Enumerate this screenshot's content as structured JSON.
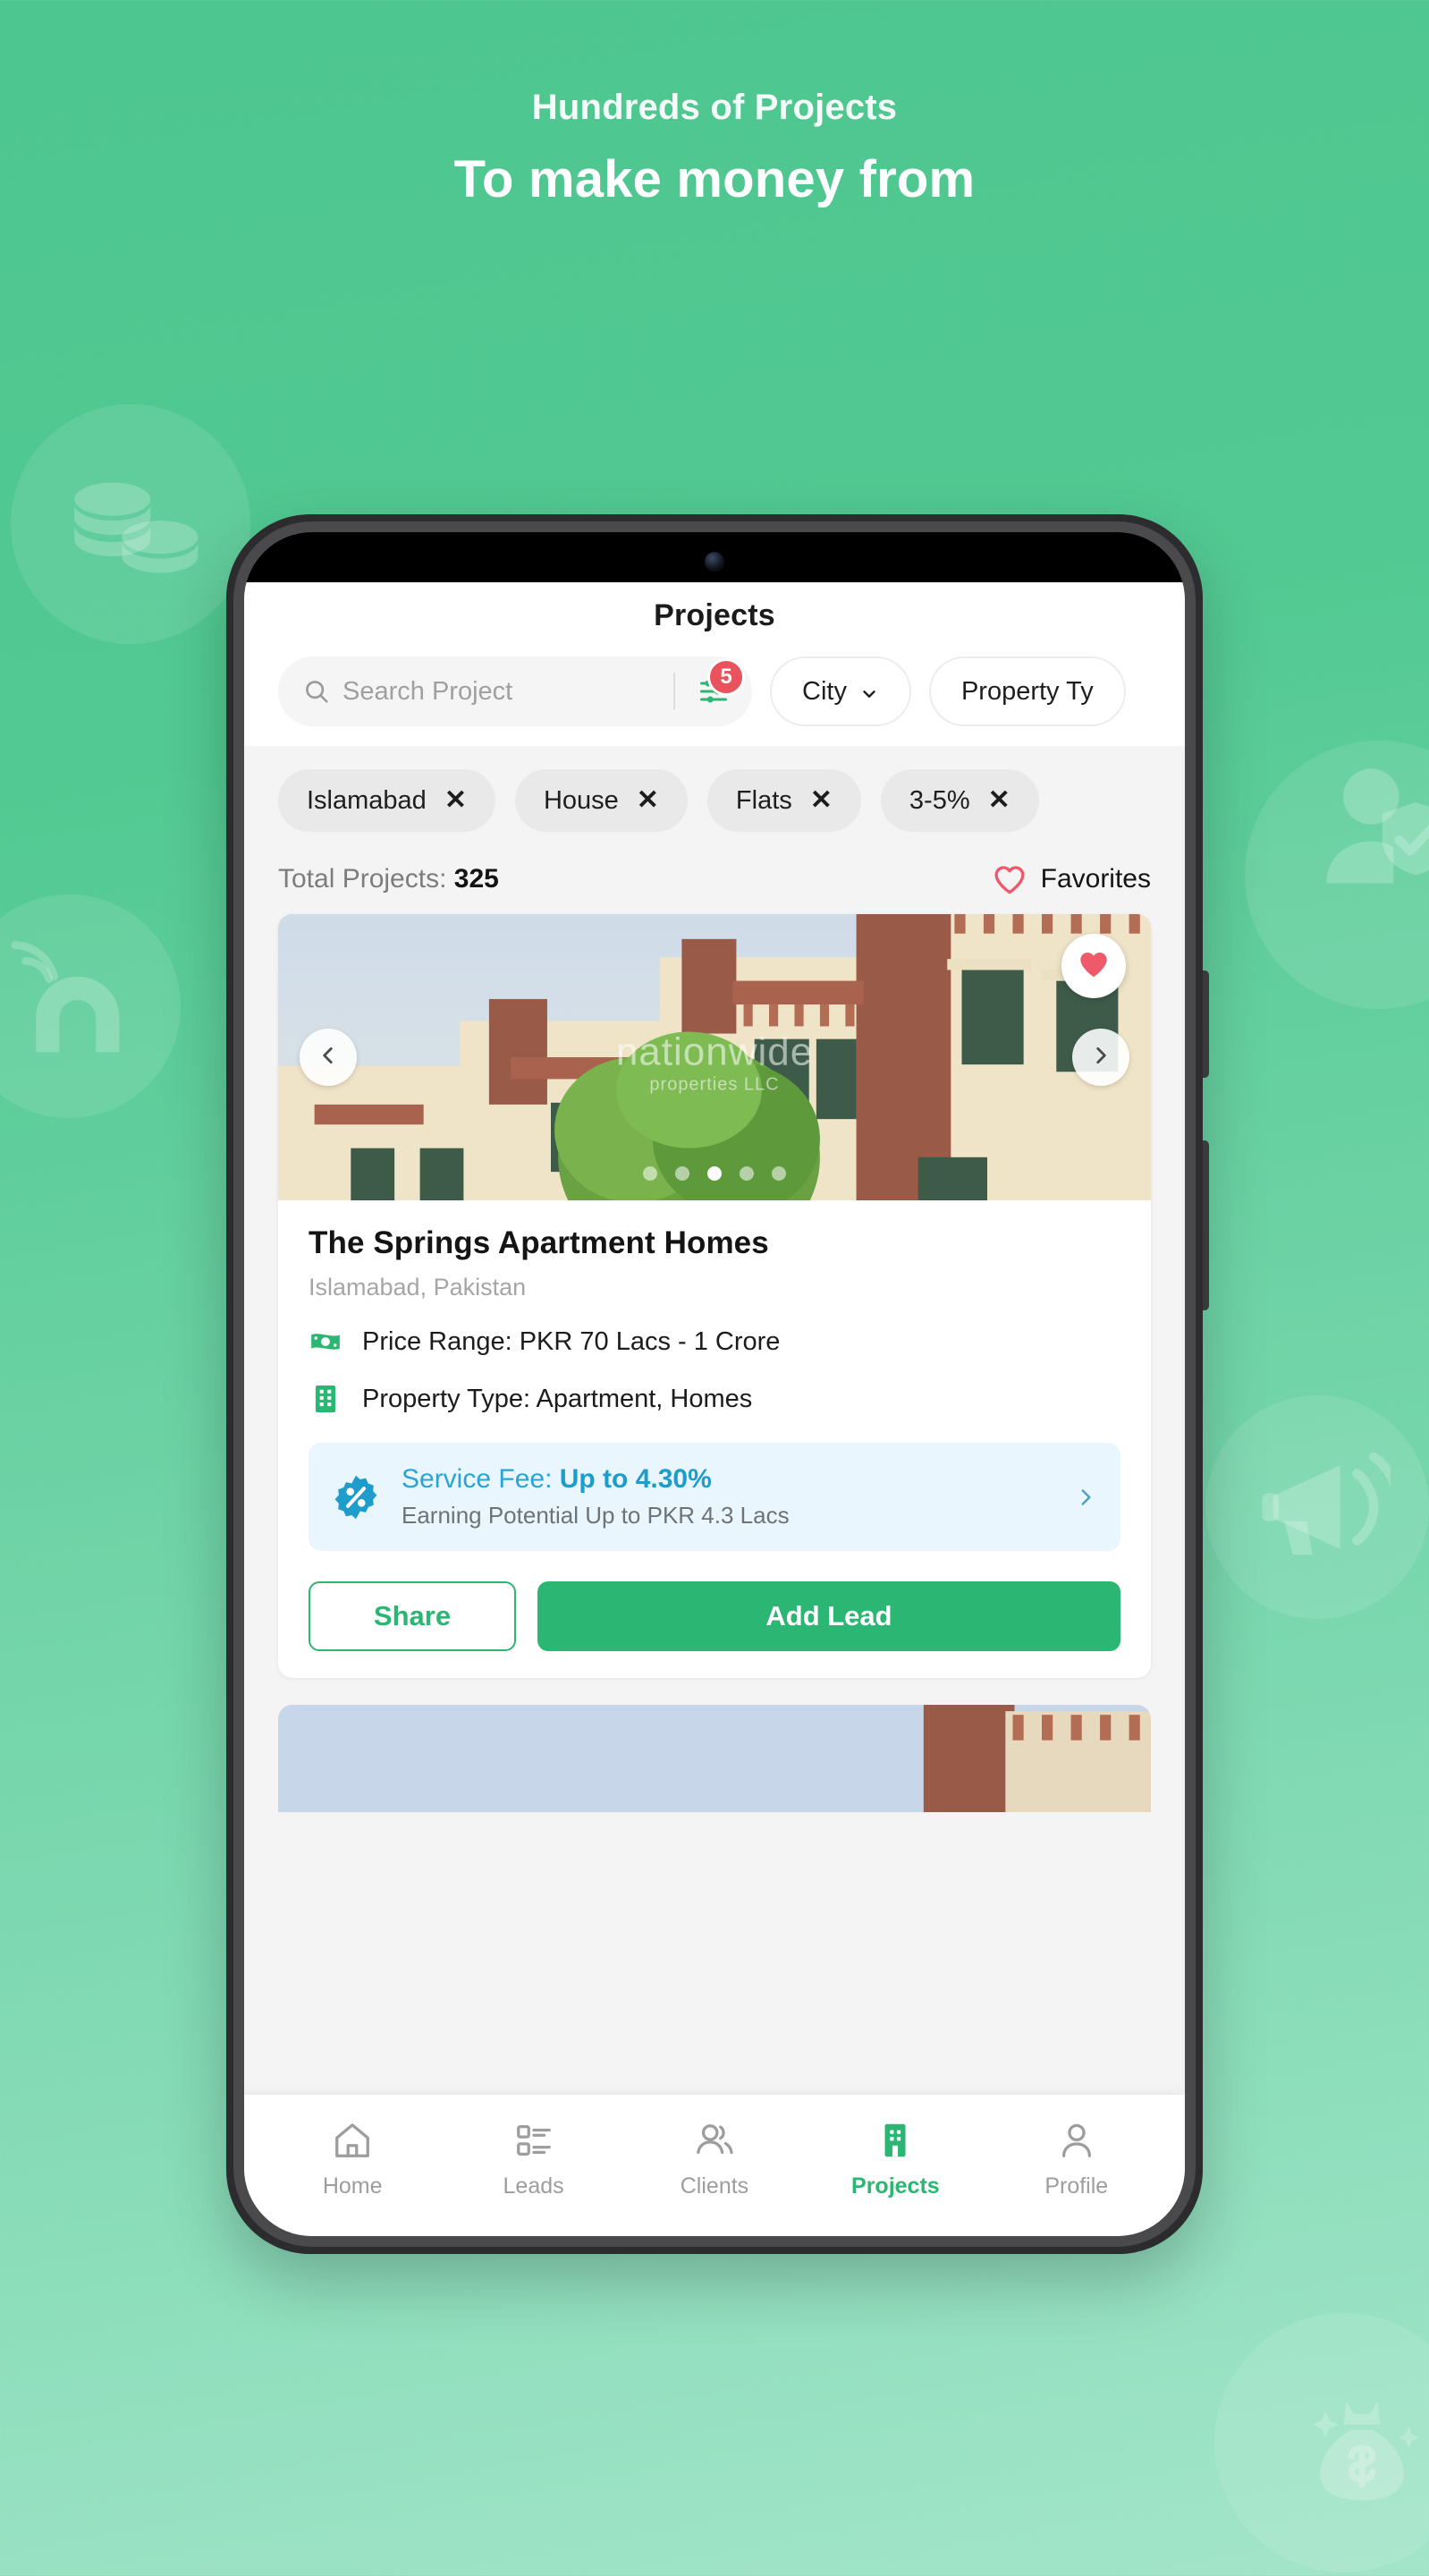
{
  "promo": {
    "headline_top": "Hundreds of Projects",
    "headline_main": "To make money from",
    "background_color": "#52c992",
    "accent_color": "#2bb673"
  },
  "decorations": [
    {
      "name": "coins-icon"
    },
    {
      "name": "verified-user-icon"
    },
    {
      "name": "megaphone-icon"
    },
    {
      "name": "magnet-call-icon"
    },
    {
      "name": "money-bag-icon"
    }
  ],
  "app": {
    "title": "Projects",
    "search": {
      "placeholder": "Search Project",
      "filter_badge_count": "5",
      "filter_icon": "sliders-icon",
      "search_icon": "search-icon"
    },
    "selects": [
      {
        "label": "City",
        "icon": "chevron-down-icon"
      },
      {
        "label": "Property Ty",
        "icon": "chevron-down-icon"
      }
    ],
    "filter_chips": [
      {
        "label": "Islamabad",
        "remove": "✕"
      },
      {
        "label": "House",
        "remove": "✕"
      },
      {
        "label": "Flats",
        "remove": "✕"
      },
      {
        "label": "3-5%",
        "remove": "✕"
      }
    ],
    "totals": {
      "label": "Total Projects:",
      "count": "325",
      "favorites_label": "Favorites",
      "favorites_icon": "heart-outline-icon"
    },
    "card": {
      "carousel": {
        "watermark": "nationwide",
        "watermark_sub": "properties LLC",
        "prev_icon": "chevron-left-icon",
        "next_icon": "chevron-right-icon",
        "favorite_icon": "heart-filled-icon",
        "dot_count": 5,
        "active_dot": 3
      },
      "title": "The Springs Apartment Homes",
      "location": "Islamabad, Pakistan",
      "meta": [
        {
          "icon": "banknote-icon",
          "text": "Price Range: PKR 70 Lacs - 1 Crore"
        },
        {
          "icon": "building-icon",
          "text": "Property Type: Apartment, Homes"
        }
      ],
      "fee": {
        "icon": "percent-badge-icon",
        "label": "Service Fee: ",
        "value": "Up to 4.30%",
        "subtitle": "Earning Potential Up to PKR 4.3 Lacs",
        "chevron": "chevron-right-icon",
        "accent_color": "#1e9ccb",
        "background_color": "#eaf6fd"
      },
      "actions": {
        "share_label": "Share",
        "add_lead_label": "Add Lead"
      }
    },
    "bottom_nav": [
      {
        "label": "Home",
        "icon": "home-icon",
        "active": false
      },
      {
        "label": "Leads",
        "icon": "list-icon",
        "active": false
      },
      {
        "label": "Clients",
        "icon": "users-icon",
        "active": false
      },
      {
        "label": "Projects",
        "icon": "building-icon",
        "active": true
      },
      {
        "label": "Profile",
        "icon": "person-icon",
        "active": false
      }
    ]
  }
}
